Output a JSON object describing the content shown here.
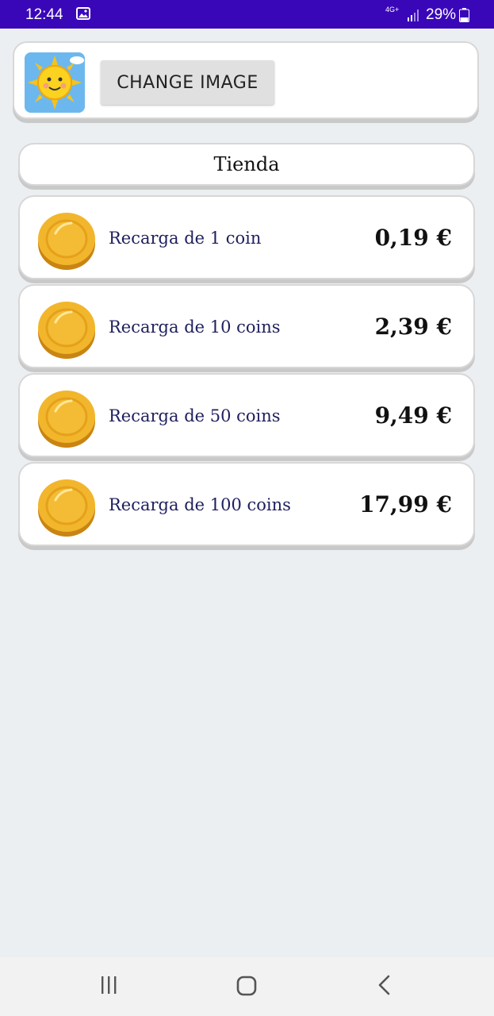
{
  "status_bar": {
    "time": "12:44",
    "network": "4G+",
    "battery": "29%"
  },
  "image_card": {
    "button_label": "CHANGE IMAGE",
    "avatar_icon": "sun-icon"
  },
  "store": {
    "title": "Tienda",
    "items": [
      {
        "label": "Recarga de 1 coin",
        "price": "0,19 €",
        "icon": "coin-icon"
      },
      {
        "label": "Recarga de 10 coins",
        "price": "2,39 €",
        "icon": "coin-icon"
      },
      {
        "label": "Recarga de 50 coins",
        "price": "9,49 €",
        "icon": "coin-icon"
      },
      {
        "label": "Recarga de 100 coins",
        "price": "17,99 €",
        "icon": "coin-icon"
      }
    ]
  },
  "nav_bar": {
    "buttons": [
      "recent-apps-icon",
      "home-icon",
      "back-icon"
    ]
  },
  "colors": {
    "status_bar": "#3a07b8",
    "background": "#eceff2",
    "label_text": "#1f1f5e",
    "coin": "#f2b62c"
  }
}
